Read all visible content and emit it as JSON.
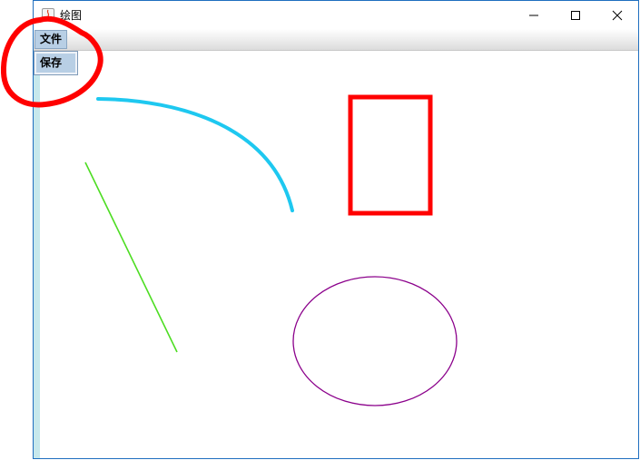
{
  "window": {
    "title": "绘图",
    "controls": {
      "minimize": "minimize-icon",
      "maximize": "maximize-icon",
      "close": "close-icon"
    }
  },
  "menubar": {
    "items": [
      {
        "label": "文件"
      }
    ]
  },
  "file_menu": {
    "items": [
      {
        "label": "保存"
      }
    ]
  },
  "drawing": {
    "shapes": [
      {
        "kind": "arc",
        "color": "#1ec8f0"
      },
      {
        "kind": "rectangle",
        "color": "#ff0000"
      },
      {
        "kind": "line",
        "color": "#4ddd22"
      },
      {
        "kind": "ellipse",
        "color": "#8b008b"
      }
    ],
    "annotation": {
      "kind": "freehand-circle",
      "color": "#ff0000"
    }
  }
}
